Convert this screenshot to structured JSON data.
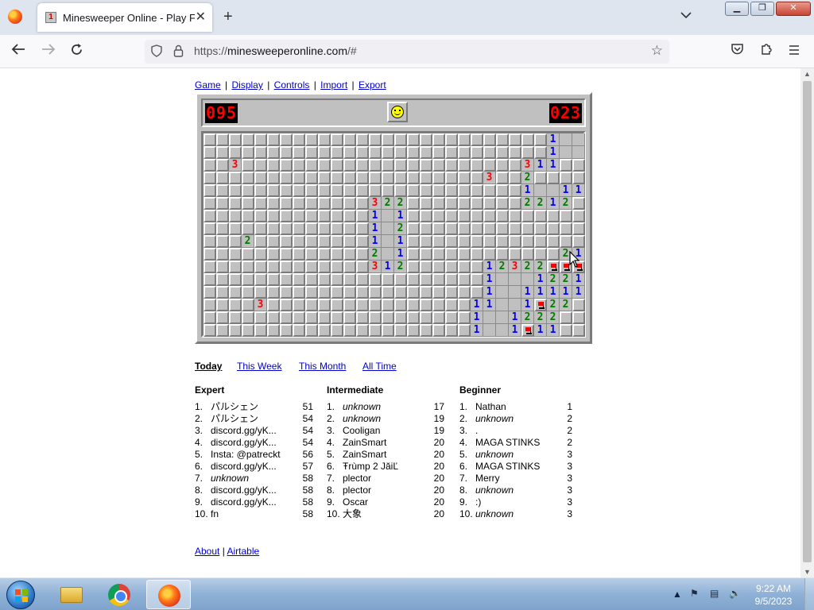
{
  "browser": {
    "tab_title": "Minesweeper Online - Play Free",
    "tab_favicon_text": "1",
    "url_prefix": "https://",
    "url_host": "minesweeperonline.com",
    "url_rest": "/#",
    "new_tab_label": "+",
    "close_tab_label": "✕",
    "tab_list_label": "⌄"
  },
  "menu": {
    "game": "Game",
    "display": "Display",
    "controls": "Controls",
    "import": "Import",
    "export": "Export",
    "sep": "|"
  },
  "game": {
    "mines_left": "095",
    "timer": "023",
    "smiley_state": "smile",
    "rows": 16,
    "cols": 30,
    "number_colors": {
      "1": "#0000ff",
      "2": "#007b00",
      "3": "#ff0000"
    },
    "opened_cells": [
      {
        "r": 0,
        "c": 27,
        "v": 1
      },
      {
        "r": 0,
        "c": 28,
        "v": 0
      },
      {
        "r": 0,
        "c": 29,
        "v": 0
      },
      {
        "r": 1,
        "c": 27,
        "v": 1
      },
      {
        "r": 1,
        "c": 28,
        "v": 0
      },
      {
        "r": 1,
        "c": 29,
        "v": 0
      },
      {
        "r": 2,
        "c": 2,
        "v": 3
      },
      {
        "r": 2,
        "c": 25,
        "v": 3
      },
      {
        "r": 2,
        "c": 26,
        "v": 1
      },
      {
        "r": 2,
        "c": 27,
        "v": 1
      },
      {
        "r": 3,
        "c": 22,
        "v": 3
      },
      {
        "r": 3,
        "c": 25,
        "v": 2
      },
      {
        "r": 4,
        "c": 25,
        "v": 1
      },
      {
        "r": 4,
        "c": 26,
        "v": 0
      },
      {
        "r": 4,
        "c": 27,
        "v": 0
      },
      {
        "r": 4,
        "c": 28,
        "v": 1
      },
      {
        "r": 4,
        "c": 29,
        "v": 1
      },
      {
        "r": 5,
        "c": 13,
        "v": 3
      },
      {
        "r": 5,
        "c": 14,
        "v": 2
      },
      {
        "r": 5,
        "c": 15,
        "v": 2
      },
      {
        "r": 5,
        "c": 25,
        "v": 2
      },
      {
        "r": 5,
        "c": 26,
        "v": 2
      },
      {
        "r": 5,
        "c": 27,
        "v": 1
      },
      {
        "r": 5,
        "c": 28,
        "v": 2
      },
      {
        "r": 6,
        "c": 13,
        "v": 1
      },
      {
        "r": 6,
        "c": 14,
        "v": 0
      },
      {
        "r": 6,
        "c": 15,
        "v": 1
      },
      {
        "r": 7,
        "c": 13,
        "v": 1
      },
      {
        "r": 7,
        "c": 14,
        "v": 0
      },
      {
        "r": 7,
        "c": 15,
        "v": 2
      },
      {
        "r": 8,
        "c": 3,
        "v": 2
      },
      {
        "r": 8,
        "c": 13,
        "v": 1
      },
      {
        "r": 8,
        "c": 14,
        "v": 0
      },
      {
        "r": 8,
        "c": 15,
        "v": 1
      },
      {
        "r": 9,
        "c": 13,
        "v": 2
      },
      {
        "r": 9,
        "c": 14,
        "v": 0
      },
      {
        "r": 9,
        "c": 15,
        "v": 1
      },
      {
        "r": 9,
        "c": 28,
        "v": 2
      },
      {
        "r": 9,
        "c": 29,
        "v": 1
      },
      {
        "r": 10,
        "c": 13,
        "v": 3
      },
      {
        "r": 10,
        "c": 14,
        "v": 1
      },
      {
        "r": 10,
        "c": 15,
        "v": 2
      },
      {
        "r": 10,
        "c": 22,
        "v": 1
      },
      {
        "r": 10,
        "c": 23,
        "v": 2
      },
      {
        "r": 10,
        "c": 24,
        "v": 3
      },
      {
        "r": 10,
        "c": 25,
        "v": 2
      },
      {
        "r": 10,
        "c": 26,
        "v": 2
      },
      {
        "r": 11,
        "c": 22,
        "v": 1
      },
      {
        "r": 11,
        "c": 23,
        "v": 0
      },
      {
        "r": 11,
        "c": 24,
        "v": 0
      },
      {
        "r": 11,
        "c": 25,
        "v": 0
      },
      {
        "r": 11,
        "c": 26,
        "v": 1
      },
      {
        "r": 11,
        "c": 27,
        "v": 2
      },
      {
        "r": 11,
        "c": 28,
        "v": 2
      },
      {
        "r": 11,
        "c": 29,
        "v": 1
      },
      {
        "r": 12,
        "c": 22,
        "v": 1
      },
      {
        "r": 12,
        "c": 23,
        "v": 0
      },
      {
        "r": 12,
        "c": 24,
        "v": 0
      },
      {
        "r": 12,
        "c": 25,
        "v": 1
      },
      {
        "r": 12,
        "c": 26,
        "v": 1
      },
      {
        "r": 12,
        "c": 27,
        "v": 1
      },
      {
        "r": 12,
        "c": 28,
        "v": 1
      },
      {
        "r": 12,
        "c": 29,
        "v": 1
      },
      {
        "r": 13,
        "c": 21,
        "v": 1
      },
      {
        "r": 13,
        "c": 22,
        "v": 1
      },
      {
        "r": 13,
        "c": 23,
        "v": 0
      },
      {
        "r": 13,
        "c": 24,
        "v": 0
      },
      {
        "r": 13,
        "c": 25,
        "v": 1
      },
      {
        "r": 13,
        "c": 27,
        "v": 2
      },
      {
        "r": 13,
        "c": 28,
        "v": 2
      },
      {
        "r": 13,
        "c": 4,
        "v": 3
      },
      {
        "r": 14,
        "c": 21,
        "v": 1
      },
      {
        "r": 14,
        "c": 22,
        "v": 0
      },
      {
        "r": 14,
        "c": 23,
        "v": 0
      },
      {
        "r": 14,
        "c": 24,
        "v": 1
      },
      {
        "r": 14,
        "c": 25,
        "v": 2
      },
      {
        "r": 14,
        "c": 26,
        "v": 2
      },
      {
        "r": 14,
        "c": 27,
        "v": 2
      },
      {
        "r": 15,
        "c": 21,
        "v": 1
      },
      {
        "r": 15,
        "c": 22,
        "v": 0
      },
      {
        "r": 15,
        "c": 23,
        "v": 0
      },
      {
        "r": 15,
        "c": 24,
        "v": 1
      },
      {
        "r": 15,
        "c": 26,
        "v": 1
      },
      {
        "r": 15,
        "c": 27,
        "v": 1
      }
    ],
    "flagged_cells": [
      {
        "r": 10,
        "c": 27
      },
      {
        "r": 10,
        "c": 28
      },
      {
        "r": 10,
        "c": 29
      },
      {
        "r": 13,
        "c": 26
      },
      {
        "r": 15,
        "c": 25
      }
    ]
  },
  "leaderboard": {
    "periods": [
      "Today",
      "This Week",
      "This Month",
      "All Time"
    ],
    "active_period": "Today",
    "columns": [
      {
        "title": "Expert",
        "rows": [
          {
            "rank": "1.",
            "name": "パルシェン",
            "score": "51",
            "italic": false
          },
          {
            "rank": "2.",
            "name": "パルシェン",
            "score": "54",
            "italic": false
          },
          {
            "rank": "3.",
            "name": "discord.gg/yK...",
            "score": "54",
            "italic": false
          },
          {
            "rank": "4.",
            "name": "discord.gg/yK...",
            "score": "54",
            "italic": false
          },
          {
            "rank": "5.",
            "name": "Insta: @patreckt",
            "score": "56",
            "italic": false
          },
          {
            "rank": "6.",
            "name": "discord.gg/yK...",
            "score": "57",
            "italic": false
          },
          {
            "rank": "7.",
            "name": "unknown",
            "score": "58",
            "italic": true
          },
          {
            "rank": "8.",
            "name": "discord.gg/yK...",
            "score": "58",
            "italic": false
          },
          {
            "rank": "9.",
            "name": "discord.gg/yK...",
            "score": "58",
            "italic": false
          },
          {
            "rank": "10.",
            "name": "fn",
            "score": "58",
            "italic": false
          }
        ]
      },
      {
        "title": "Intermediate",
        "rows": [
          {
            "rank": "1.",
            "name": "unknown",
            "score": "17",
            "italic": true
          },
          {
            "rank": "2.",
            "name": "unknown",
            "score": "19",
            "italic": true
          },
          {
            "rank": "3.",
            "name": "Cooligan",
            "score": "19",
            "italic": false
          },
          {
            "rank": "4.",
            "name": "ZainSmart",
            "score": "20",
            "italic": false
          },
          {
            "rank": "5.",
            "name": "ZainSmart",
            "score": "20",
            "italic": false
          },
          {
            "rank": "6.",
            "name": "Ŧrùmp 2 JăiĽ",
            "score": "20",
            "italic": false
          },
          {
            "rank": "7.",
            "name": "plector",
            "score": "20",
            "italic": false
          },
          {
            "rank": "8.",
            "name": "plector",
            "score": "20",
            "italic": false
          },
          {
            "rank": "9.",
            "name": "Oscar",
            "score": "20",
            "italic": false
          },
          {
            "rank": "10.",
            "name": "大象",
            "score": "20",
            "italic": false
          }
        ]
      },
      {
        "title": "Beginner",
        "rows": [
          {
            "rank": "1.",
            "name": "Nathan",
            "score": "1",
            "italic": false
          },
          {
            "rank": "2.",
            "name": "unknown",
            "score": "2",
            "italic": true
          },
          {
            "rank": "3.",
            "name": ".",
            "score": "2",
            "italic": false
          },
          {
            "rank": "4.",
            "name": "MAGA STINKS",
            "score": "2",
            "italic": false
          },
          {
            "rank": "5.",
            "name": "unknown",
            "score": "3",
            "italic": true
          },
          {
            "rank": "6.",
            "name": "MAGA STINKS",
            "score": "3",
            "italic": false
          },
          {
            "rank": "7.",
            "name": "Merry",
            "score": "3",
            "italic": false
          },
          {
            "rank": "8.",
            "name": "unknown",
            "score": "3",
            "italic": true
          },
          {
            "rank": "9.",
            "name": ":)",
            "score": "3",
            "italic": false
          },
          {
            "rank": "10.",
            "name": "unknown",
            "score": "3",
            "italic": true
          }
        ]
      }
    ]
  },
  "footer": {
    "about": "About",
    "airtable": "Airtable",
    "sep": "|"
  },
  "taskbar": {
    "time": "9:22 AM",
    "date": "9/5/2023",
    "tray_arrow": "▲"
  }
}
